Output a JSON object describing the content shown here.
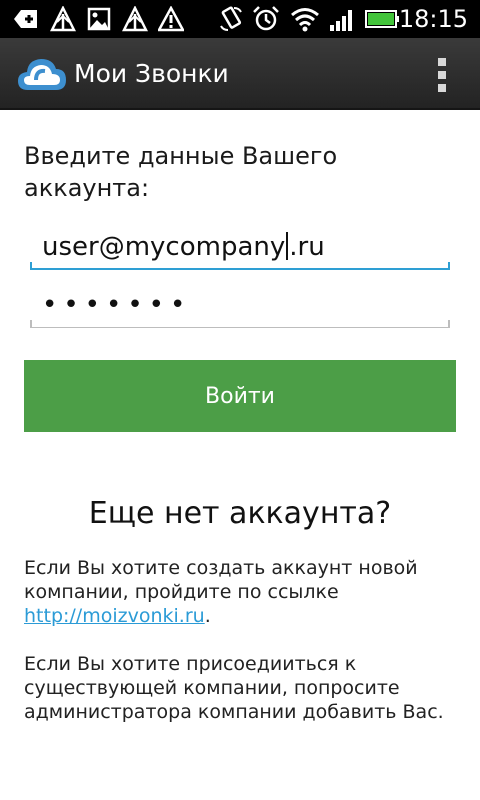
{
  "status_bar": {
    "time": "18:15",
    "icons": [
      "add-icon",
      "warning-signal-icon",
      "image-icon",
      "warning-signal-icon",
      "alert-icon",
      "rotate-icon",
      "alarm-icon",
      "wifi-icon",
      "signal-icon",
      "battery-icon"
    ]
  },
  "action_bar": {
    "title": "Мои Звонки",
    "logo_icon": "cloud-icon",
    "menu_icon": "overflow-menu-icon"
  },
  "login": {
    "prompt": "Введите данные Вашего аккаунта:",
    "email_before_cursor": "user@mycompany",
    "email_after_cursor": ".ru",
    "password_mask": "•••••••",
    "submit_label": "Войти"
  },
  "signup": {
    "heading": "Еще нет аккаунта?",
    "para1_text": "Если Вы хотите создать аккаунт новой компании, пройдите по ссылке ",
    "para1_link": "http://moizvonki.ru",
    "para1_end": ".",
    "para2_text": "Если Вы хотите присоедииться к существующей компании, попросите администратора компании добавить Вас."
  },
  "colors": {
    "accent_blue": "#2e9fd4",
    "button_green": "#4c9e47",
    "link_blue": "#2b9bd6"
  }
}
